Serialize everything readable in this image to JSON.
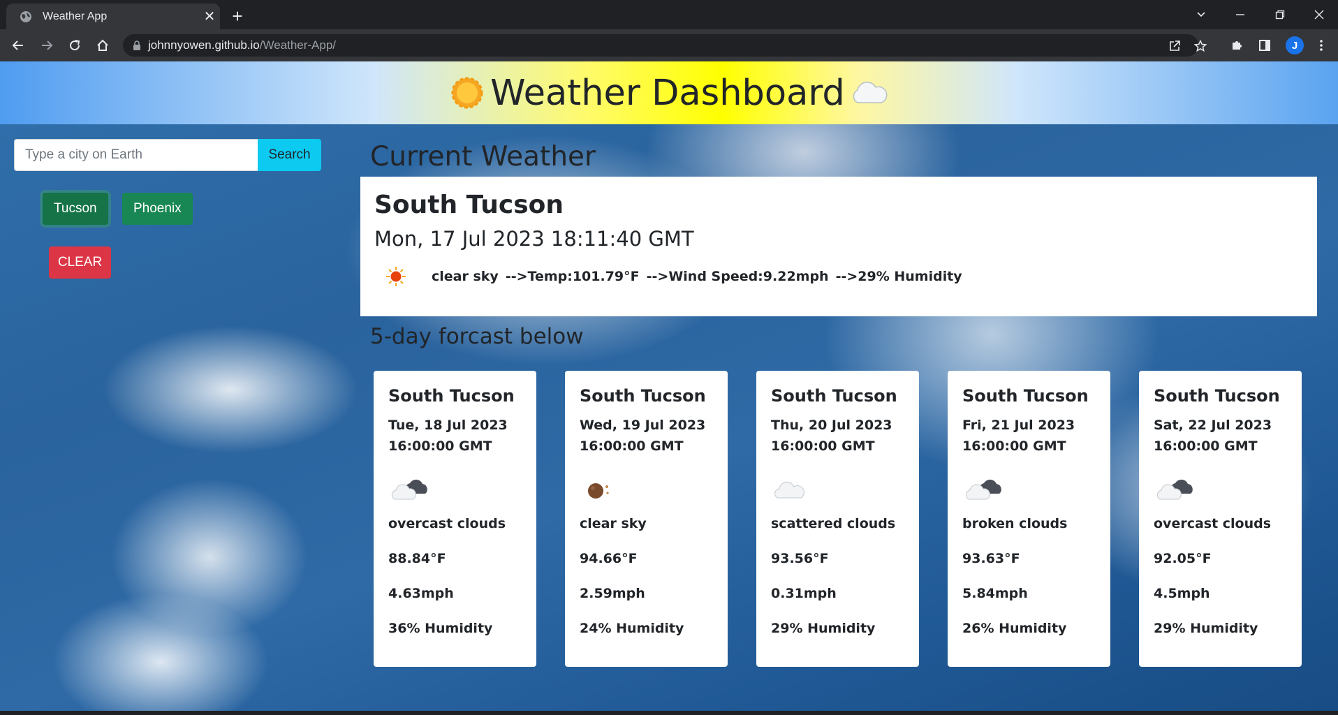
{
  "browser": {
    "tab_title": "Weather App",
    "url_host": "johnnyowen.github.io",
    "url_path": "/Weather-App/",
    "profile_initial": "J"
  },
  "header": {
    "title": "Weather Dashboard"
  },
  "search": {
    "placeholder": "Type a city on Earth",
    "button_label": "Search"
  },
  "history": [
    "Tucson",
    "Phoenix"
  ],
  "clear_label": "CLEAR",
  "current": {
    "section_title": "Current Weather",
    "city": "South Tucson",
    "datetime": "Mon, 17 Jul 2023 18:11:40 GMT",
    "icon": "clear-sky-sun-icon",
    "description": "clear sky",
    "temp": "-->Temp:101.79°F",
    "wind": "-->Wind Speed:9.22mph",
    "humidity": "-->29% Humidity"
  },
  "forecast_title": "5-day forcast below",
  "forecast": [
    {
      "city": "South Tucson",
      "date": "Tue, 18 Jul 2023",
      "time": "16:00:00 GMT",
      "icon": "overcast-clouds-icon",
      "description": "overcast clouds",
      "temp": "88.84°F",
      "wind": "4.63mph",
      "humidity": "36% Humidity"
    },
    {
      "city": "South Tucson",
      "date": "Wed, 19 Jul 2023",
      "time": "16:00:00 GMT",
      "icon": "clear-sky-night-icon",
      "description": "clear sky",
      "temp": "94.66°F",
      "wind": "2.59mph",
      "humidity": "24% Humidity"
    },
    {
      "city": "South Tucson",
      "date": "Thu, 20 Jul 2023",
      "time": "16:00:00 GMT",
      "icon": "scattered-clouds-icon",
      "description": "scattered clouds",
      "temp": "93.56°F",
      "wind": "0.31mph",
      "humidity": "29% Humidity"
    },
    {
      "city": "South Tucson",
      "date": "Fri, 21 Jul 2023",
      "time": "16:00:00 GMT",
      "icon": "broken-clouds-icon",
      "description": "broken clouds",
      "temp": "93.63°F",
      "wind": "5.84mph",
      "humidity": "26% Humidity"
    },
    {
      "city": "South Tucson",
      "date": "Sat, 22 Jul 2023",
      "time": "16:00:00 GMT",
      "icon": "overcast-clouds-icon",
      "description": "overcast clouds",
      "temp": "92.05°F",
      "wind": "4.5mph",
      "humidity": "29% Humidity"
    }
  ],
  "colors": {
    "search_button": "#0dcaf0",
    "history_button": "#198754",
    "clear_button": "#dc3545",
    "header_center": "#ffff00"
  }
}
